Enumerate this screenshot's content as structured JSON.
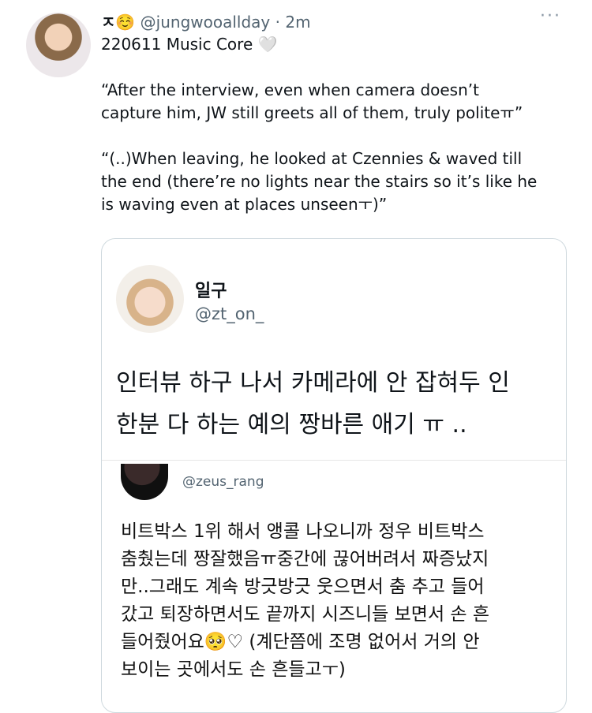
{
  "tweet": {
    "display_name": "ㅈ☺️",
    "handle": "@jungwooallday",
    "time": "· 2m",
    "more": "···",
    "line1": "220611 Music Core 🤍",
    "quote1_line1": "“After the interview, even when camera doesn’t",
    "quote1_line2": "capture him, JW still greets all of them, truly politeㅠ”",
    "quote2_line1": "“(..)When leaving, he looked at Czennies & waved till",
    "quote2_line2": "the end (there’re no lights near the stairs so it’s like he",
    "quote2_line3": "is waving even at places unseenㅜ)”"
  },
  "quoted": {
    "name": "일구",
    "handle": "@zt_on_",
    "text_line1": "인터뷰 하구 나서 카메라에 안 잡혀두 인",
    "text_line2": "한분 다 하는 예의 짱바른 애기 ㅠ ..",
    "inner": {
      "handle": "@zeus_rang",
      "lines": [
        "비트박스 1위 해서 앵콜 나오니까 정우 비트박스",
        "춤췄는데 짱잘했음ㅠ중간에 끊어버려서 짜증났지",
        "만..그래도 계속 방긋방긋 웃으면서 춤 추고 들어",
        "갔고 퇴장하면서도 끝까지 시즈니들 보면서 손 흔",
        "들어줬어요🥺♡ (계단쯤에 조명 없어서 거의 안",
        "보이는 곳에서도 손 흔들고ㅜ)"
      ]
    }
  }
}
